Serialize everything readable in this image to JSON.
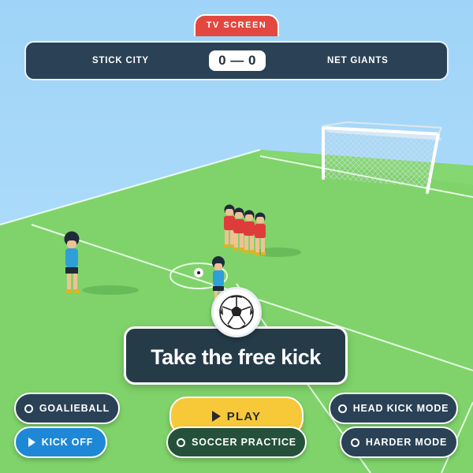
{
  "header": {
    "tab_label": "TV SCREEN",
    "home_team": "STICK CITY",
    "away_team": "NET GIANTS",
    "score": "0 — 0"
  },
  "prompt": {
    "ball_icon": "soccer-ball-icon",
    "text": "Take the free kick"
  },
  "buttons": {
    "goalieball": "GOALIEBALL",
    "kick_off": "KICK OFF",
    "play": "PLAY",
    "soccer_practice": "SOCCER PRACTICE",
    "head_kick_mode": "HEAD KICK MODE",
    "harder_mode": "HARDER MODE"
  },
  "colors": {
    "sky": "#9fd3f7",
    "pitch": "#7fd36a",
    "panel": "#2b4256",
    "accent_red": "#e2483f",
    "play_yellow": "#f7c938",
    "kick_off_blue": "#1e88d6",
    "practice_green": "#25513a",
    "home_kit": "#e03b3b",
    "away_kit": "#2f9fd8"
  }
}
